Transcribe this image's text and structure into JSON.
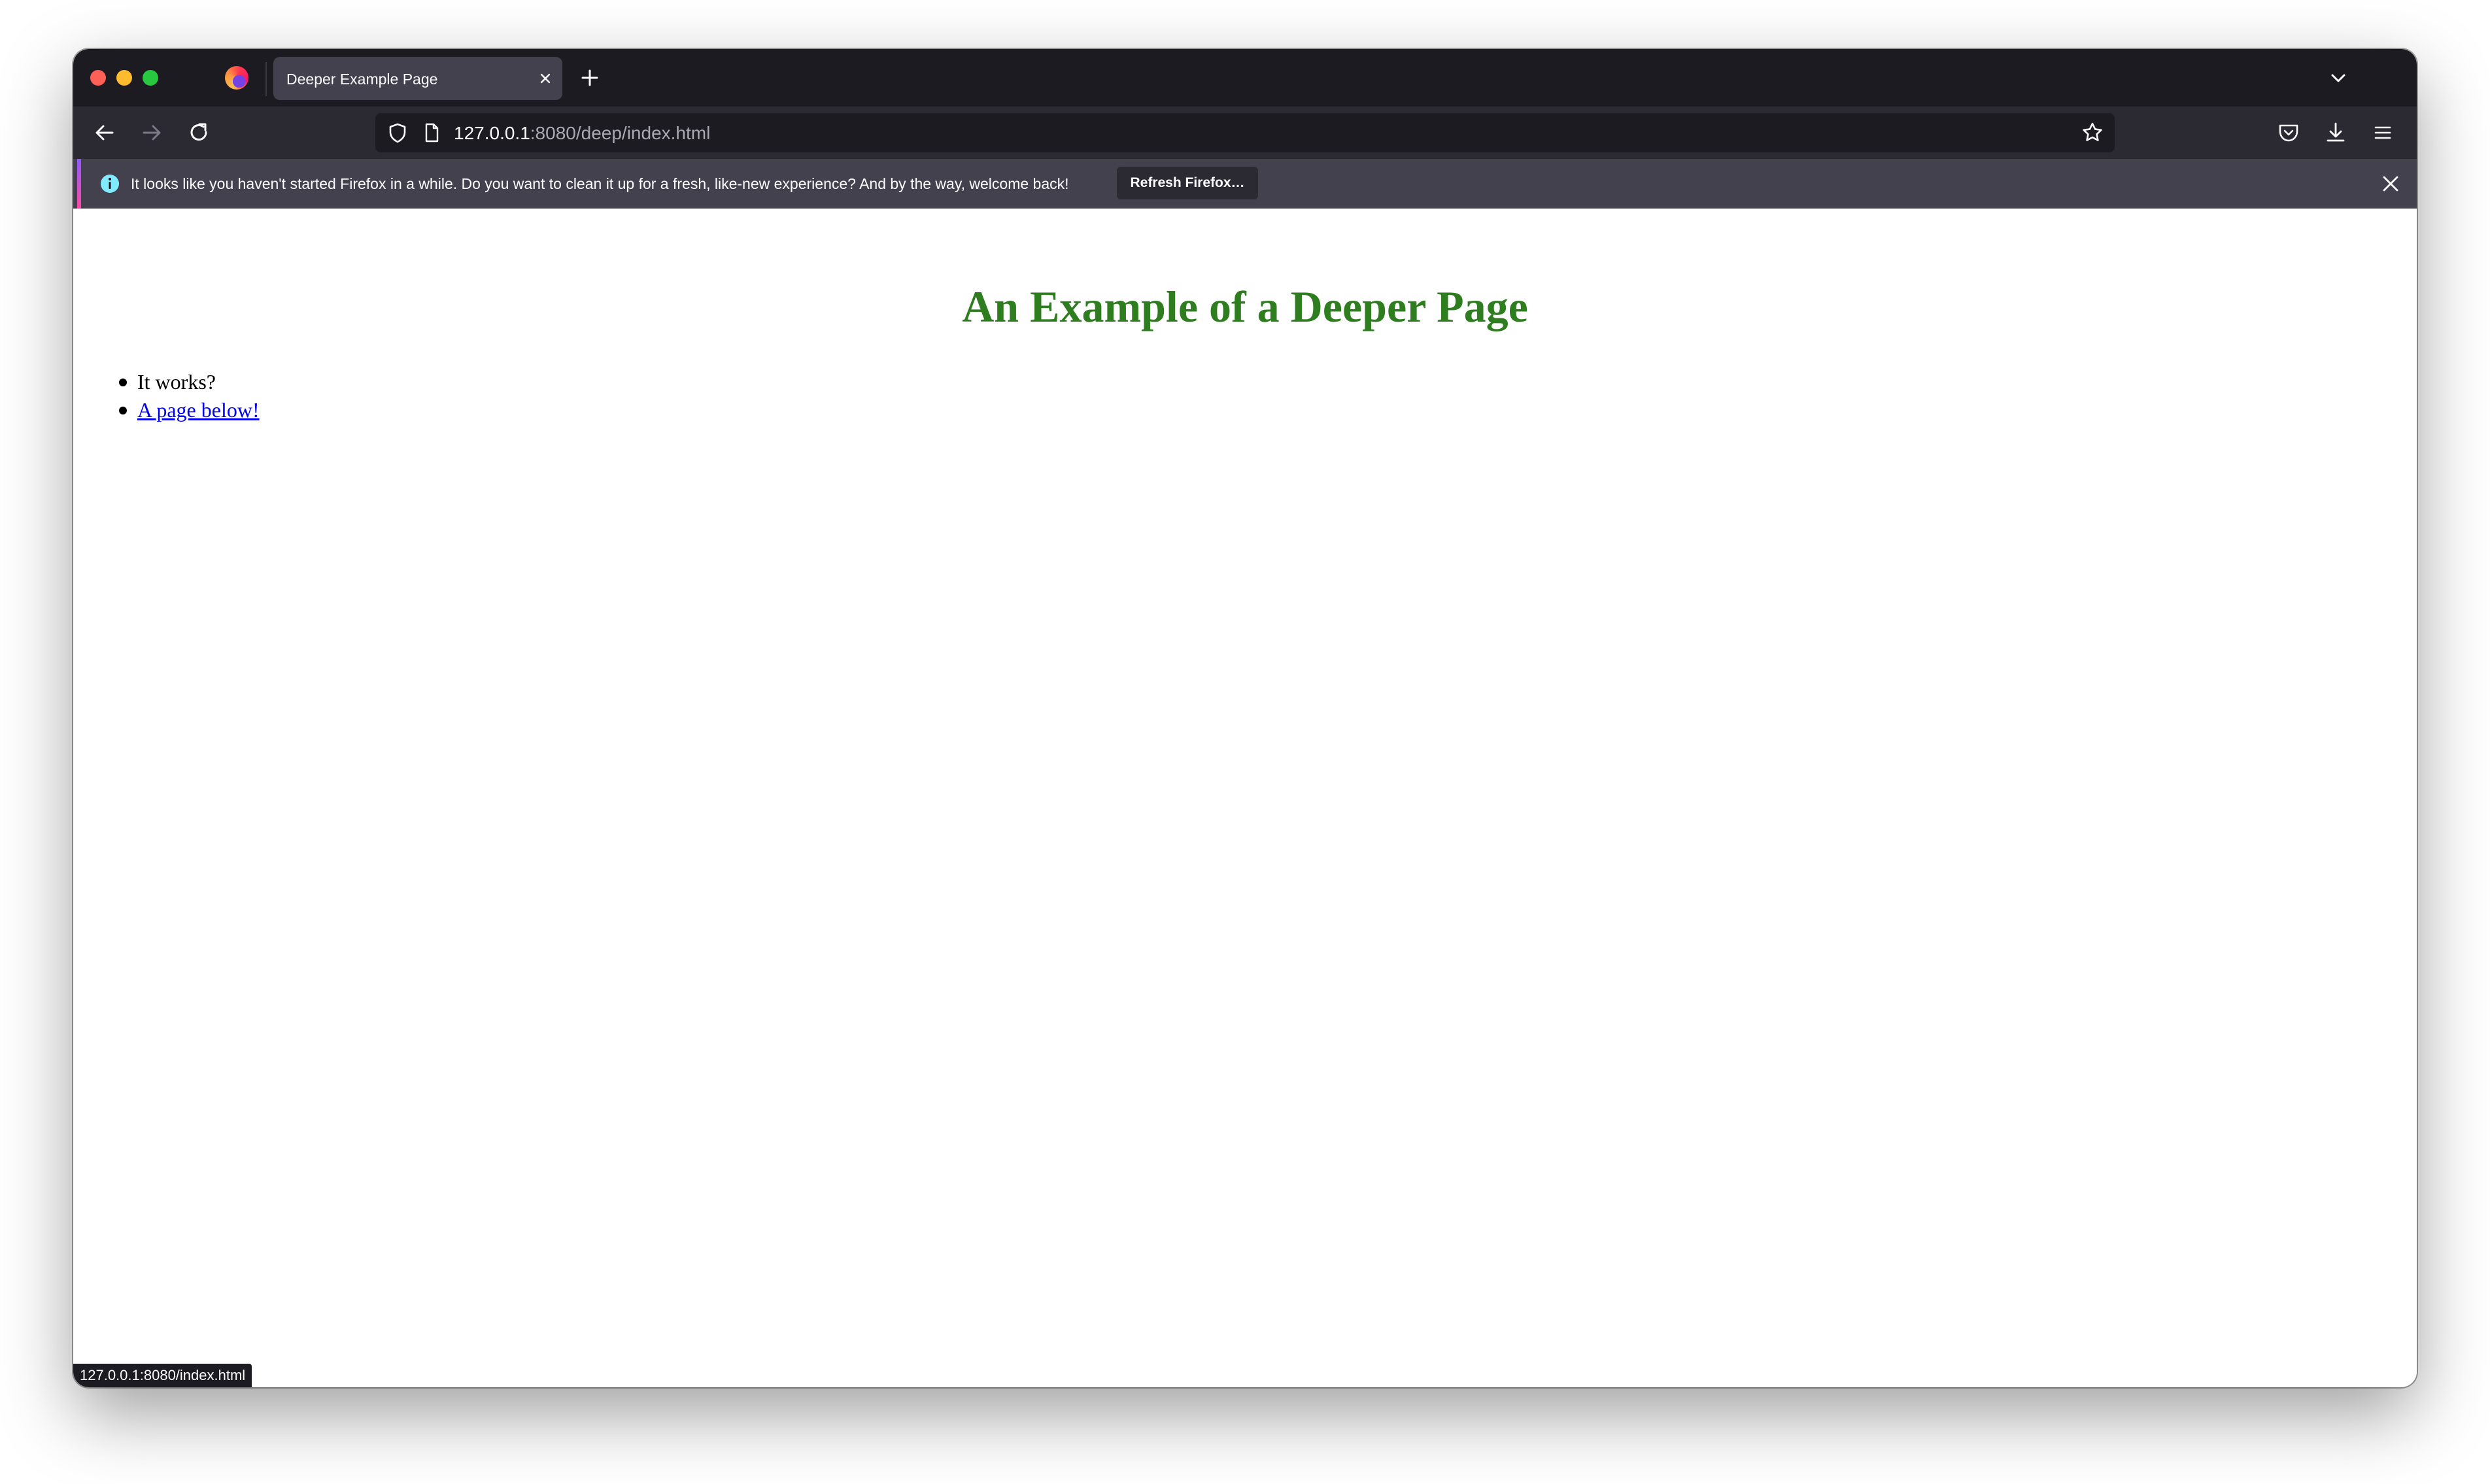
{
  "browser": {
    "tab": {
      "title": "Deeper Example Page"
    },
    "url": {
      "host": "127.0.0.1",
      "rest": ":8080/deep/index.html"
    },
    "notification": {
      "message": "It looks like you haven't started Firefox in a while. Do you want to clean it up for a fresh, like-new experience? And by the way, welcome back!",
      "button_label": "Refresh Firefox…"
    },
    "status_url": "127.0.0.1:8080/index.html"
  },
  "page": {
    "heading": "An Example of a Deeper Page",
    "items": [
      {
        "text": "It works?"
      },
      {
        "text": "A page below!"
      }
    ]
  },
  "icons": {
    "traffic_close": "#fe5f57",
    "traffic_min": "#febc2e",
    "traffic_max": "#28c840",
    "heading_color": "#2e7d1f",
    "link_color": "#0000ee",
    "names": [
      "firefox-logo-icon",
      "tab-close-icon",
      "new-tab-icon",
      "tab-list-chevron-icon",
      "back-arrow-icon",
      "forward-arrow-icon",
      "reload-icon",
      "tracking-shield-icon",
      "page-icon",
      "bookmark-star-icon",
      "pocket-icon",
      "download-icon",
      "hamburger-menu-icon",
      "info-icon",
      "close-icon"
    ]
  }
}
